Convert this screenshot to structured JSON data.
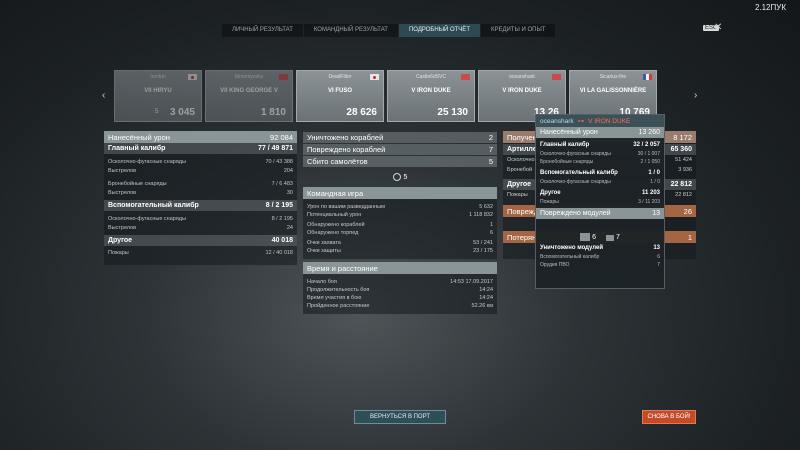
{
  "version": "2.12ПУК",
  "tabs": [
    {
      "label": "ЛИЧНЫЙ РЕЗУЛЬТАТ"
    },
    {
      "label": "КОМАНДНЫЙ РЕЗУЛЬТАТ"
    },
    {
      "label": "ПОДРОБНЫЙ ОТЧЁТ"
    },
    {
      "label": "КРЕДИТЫ И ОПЫТ"
    }
  ],
  "esc": {
    "key": "ESC",
    "close": "✕"
  },
  "nav": {
    "prev": "‹",
    "next": "›"
  },
  "ships": [
    {
      "player": "Ironfun",
      "name": "VII HIRYU",
      "kills": "5",
      "damage": "3 045"
    },
    {
      "player": "Morentynsky",
      "name": "VII KING GEORGE V",
      "kills": "",
      "damage": "1 810"
    },
    {
      "player": "DeadFilter",
      "name": "VI FUSO",
      "kills": "",
      "damage": "28 626"
    },
    {
      "player": "Castle6dSVC",
      "name": "V IRON DUKE",
      "kills": "",
      "damage": "25 130"
    },
    {
      "player": "oceanshark",
      "name": "V IRON DUKE",
      "kills": "",
      "damage": "13 26"
    },
    {
      "player": "Sicarius-fire",
      "name": "VI LA GALISSONNIÈRE",
      "kills": "",
      "damage": "10 769"
    }
  ],
  "left_panel": {
    "total_label": "Нанесённый урон",
    "total_value": "92 084",
    "main_label": "Главный калибр",
    "main_value": "77 / 49 871",
    "he_label": "Осколочно-фугасные снаряды",
    "he_value": "70 / 43 388",
    "shots_label": "Выстрелов",
    "shots_value": "204",
    "ap_label": "Бронебойные снаряды",
    "ap_value": "7 / 6 483",
    "ap_shots_label": "Выстрелов",
    "ap_shots_value": "30",
    "sec_label": "Вспомогательный калибр",
    "sec_value": "8 / 2 195",
    "sec_he_label": "Осколочно-фугасные снаряды",
    "sec_he_value": "8 / 2 195",
    "sec_shots_label": "Выстрелов",
    "sec_shots_value": "24",
    "other_label": "Другое",
    "other_value": "40 018",
    "fires_label": "Пожары",
    "fires_value": "12 / 40 018"
  },
  "mid_panel": {
    "destroyed_label": "Уничтожено кораблей",
    "destroyed_value": "2",
    "damaged_label": "Повреждено кораблей",
    "damaged_value": "7",
    "planes_label": "Сбито самолётов",
    "planes_value": "5",
    "capture_count": "5",
    "team_title": "Командная игра",
    "team_rows": [
      {
        "label": "Урон по вашим разведданным",
        "value": "5 632"
      },
      {
        "label": "Потенциальный урон",
        "value": "1 118 832"
      },
      {
        "label": "Обнаружено кораблей",
        "value": "1"
      },
      {
        "label": "Обнаружено торпед",
        "value": "6"
      },
      {
        "label": "Очки захвата",
        "value": "53 / 241"
      },
      {
        "label": "Очки защиты",
        "value": "23 / 175"
      }
    ],
    "time_title": "Время и расстояние",
    "time_rows": [
      {
        "label": "Начало боя",
        "value": "14:53  17.09.2017"
      },
      {
        "label": "Продолжительность боя",
        "value": "14:24"
      },
      {
        "label": "Время участия в бою",
        "value": "14:24"
      },
      {
        "label": "Пройденное расстояние",
        "value": "52.26 км"
      }
    ]
  },
  "right_panel": {
    "received_label": "Получен",
    "received_value": "8 172",
    "artillery_label": "Артиллер",
    "artillery_value": "65 360",
    "s1_label": "Осколочно",
    "s1_value": "51 424",
    "s2_label": "Бронебой",
    "s2_value": "3 936",
    "other_label": "Другое",
    "other_value": "22 812",
    "fires_label": "Пожары",
    "fires_value": "22 812",
    "damaged_label": "Поврежд",
    "damaged_value": "26",
    "losses_label": "Потерян",
    "losses_value": "1"
  },
  "tooltip": {
    "player": "oceanshark",
    "ship": "V IRON DUKE",
    "dealt_label": "Нанесённый урон",
    "dealt_value": "13 260",
    "main_label": "Главный калибр",
    "main_value": "32 / 2 057",
    "he_label": "Осколочно-фугасные снаряды",
    "he_value": "30 / 1 007",
    "ap_label": "Бронебойные снаряды",
    "ap_value": "2 / 1 050",
    "sec_label": "Вспомогательный калибр",
    "sec_value": "1 / 0",
    "sec_he_label": "Осколочно-фугасные снаряды",
    "sec_he_value": "1 / 0",
    "other_label": "Другое",
    "other_value": "11 203",
    "fires_label": "Пожары",
    "fires_value": "3 / 11 203",
    "modules_label": "Повреждено модулей",
    "modules_value": "13",
    "mod_a": "6",
    "mod_b": "7",
    "destroyed_mod_label": "Уничтожено модулей",
    "destroyed_mod_value": "13",
    "secondary_label": "Вспомогательный калибр",
    "secondary_value": "6",
    "aa_label": "Орудия ПВО",
    "aa_value": "7"
  },
  "buttons": {
    "port": "ВЕРНУТЬСЯ В ПОРТ",
    "battle": "СНОВА В БОЙ!"
  }
}
